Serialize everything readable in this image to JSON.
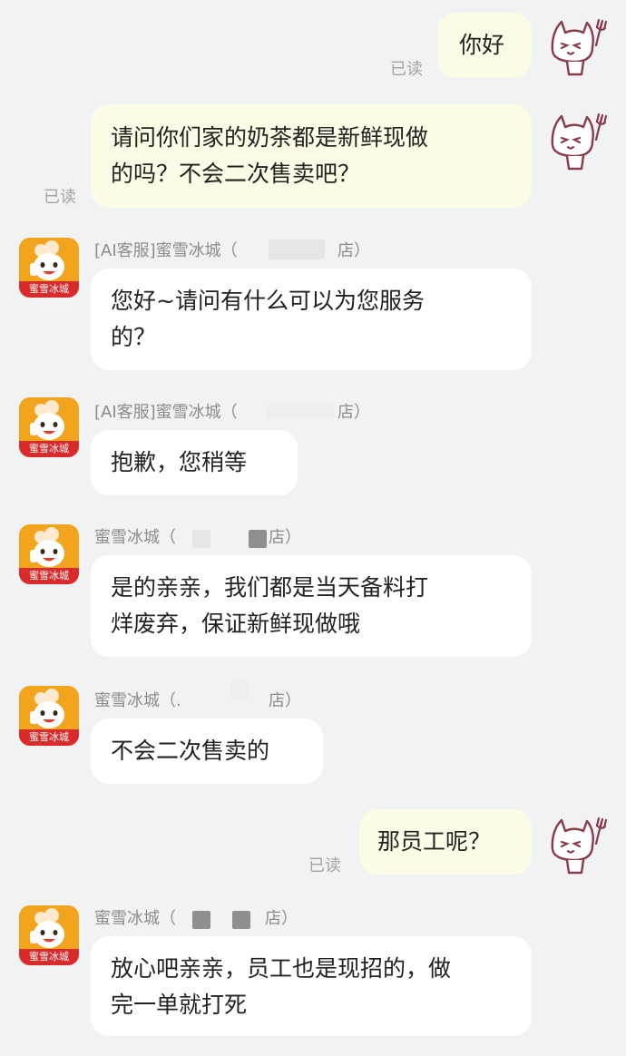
{
  "conversation": {
    "read_label": "已读",
    "messages": [
      {
        "id": "m1",
        "side": "out",
        "text": "你好",
        "read": true
      },
      {
        "id": "m2",
        "side": "out",
        "text": "请问你们家的奶茶都是新鲜现做\n的吗？不会二次售卖吧？",
        "read": true
      },
      {
        "id": "m3",
        "side": "in",
        "sender": "[AI客服]蜜雪冰城（",
        "sender_suffix": "店）",
        "text": "您好~请问有什么可以为您服务\n的？"
      },
      {
        "id": "m4",
        "side": "in",
        "sender": "[AI客服]蜜雪冰城（",
        "sender_suffix": "店）",
        "text": "抱歉，您稍等"
      },
      {
        "id": "m5",
        "side": "in",
        "sender": "蜜雪冰城（",
        "sender_suffix": "店）",
        "text": "是的亲亲，我们都是当天备料打\n烊废弃，保证新鲜现做哦"
      },
      {
        "id": "m6",
        "side": "in",
        "sender": "蜜雪冰城（.",
        "sender_suffix": "店）",
        "text": "不会二次售卖的"
      },
      {
        "id": "m7",
        "side": "out",
        "text": "那员工呢？",
        "read": true
      },
      {
        "id": "m8",
        "side": "in",
        "sender": "蜜雪冰城（",
        "sender_suffix": "店）",
        "text": "放心吧亲亲，员工也是现招的，做\n完一单就打死"
      }
    ]
  },
  "shop_avatar": {
    "label": "蜜雪冰城",
    "brand_color": "#f3a41d",
    "label_bg_color": "#d92b2b"
  },
  "self_avatar": {
    "icon": "cat-with-fork-icon",
    "line_color": "#8a3a4a"
  },
  "colors": {
    "background": "#f1f2f3",
    "outgoing_bubble": "#fcfbe5",
    "incoming_bubble": "#ffffff",
    "read_text": "#a3a3a3",
    "sender_text": "#8c8c8c"
  }
}
